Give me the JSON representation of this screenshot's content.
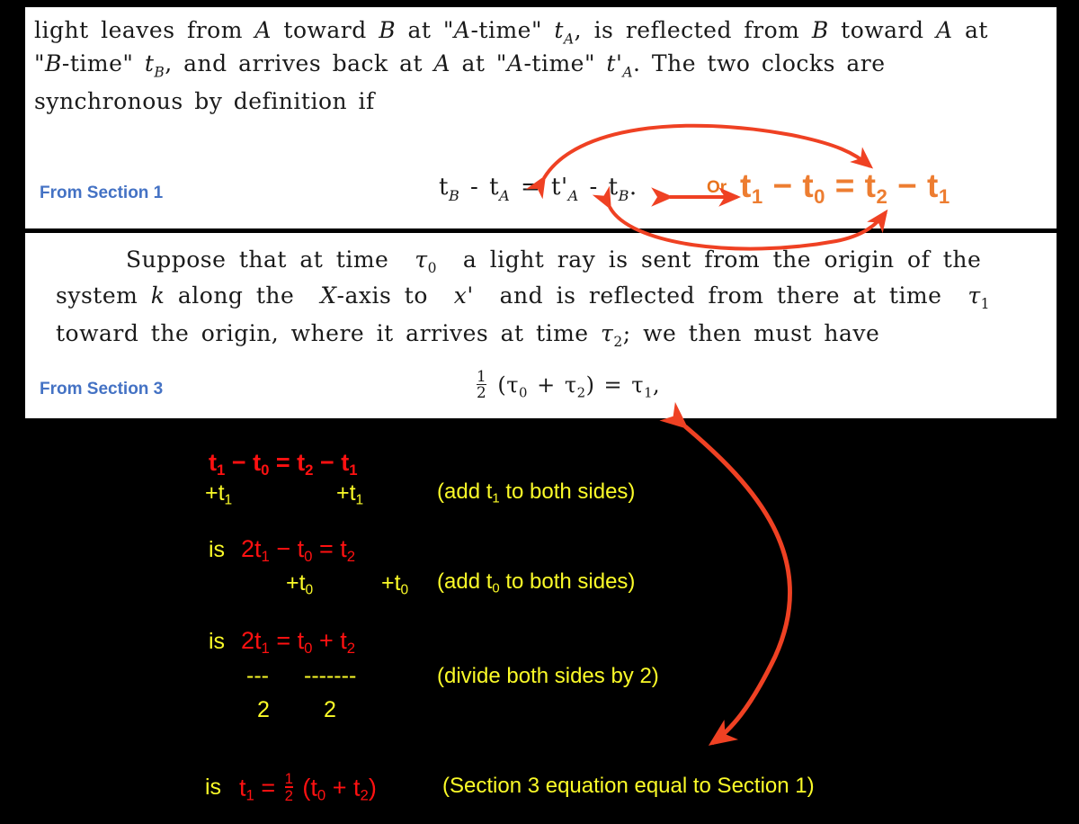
{
  "panels": {
    "section1": {
      "caption": "From Section 1",
      "lines": [
        "light leaves from A toward B at \"A-time\" tA, is reflected from B toward A at",
        "\"B-time\" tB, and arrives back at A at \"A-time\" t'A. The two clocks are",
        "synchronous by definition if"
      ],
      "equation": "tB - tA = t'A - tB."
    },
    "section3": {
      "caption": "From Section 3",
      "lines": [
        "Suppose that at time τ0 a light ray is sent from the origin of the",
        "system k along the X-axis to x' and is reflected from there at time τ1",
        "toward the origin, where it arrives at time τ2; we then must have"
      ],
      "equation": "½ (τ0 + τ2) = τ1,"
    }
  },
  "annotation": {
    "or_label": "Or",
    "orange_equation": "t1 − t0 = t2 − t1"
  },
  "derivation": {
    "step1": {
      "equation": "t1 − t0 = t2 − t1",
      "op_left": "+t1",
      "op_right": "+t1",
      "note": "(add t1 to both sides)"
    },
    "step2": {
      "is": "is",
      "equation": "2t1 − t0 = t2",
      "op_left": "+t0",
      "op_right": "+t0",
      "note": "(add t0 to both sides)"
    },
    "step3": {
      "is": "is",
      "equation": "2t1 = t0 + t2",
      "bar_left": "---",
      "bar_right": "-------",
      "den_left": "2",
      "den_right": "2",
      "note": "(divide both sides by 2)"
    },
    "step4": {
      "is": "is",
      "equation": "t1 = ½ (t0 + t2)",
      "note": "(Section 3 equation equal to Section 1)"
    }
  },
  "colors": {
    "background": "#000000",
    "paper": "#ffffff",
    "caption_blue": "#4472c4",
    "annotation_orange": "#ed7d31",
    "equation_red": "#ff1111",
    "note_yellow": "#fbfb28"
  }
}
